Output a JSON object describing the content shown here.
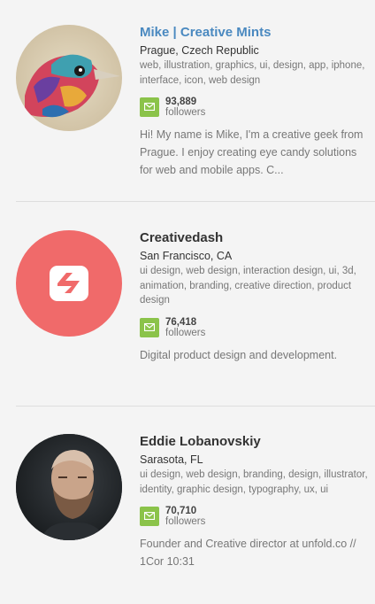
{
  "designers": [
    {
      "name": "Mike | Creative Mints",
      "location": "Prague, Czech Republic",
      "skills": "web, illustration, graphics, ui, design, app, iphone, interface, icon, web design",
      "followers_count": "93,889",
      "followers_label": "followers",
      "bio": "Hi! My name is Mike, I'm a creative geek from Prague. I enjoy creating eye candy solutions for web and mobile apps. C..."
    },
    {
      "name": "Creativedash",
      "location": "San Francisco, CA",
      "skills": "ui design, web design, interaction design, ui, 3d, animation, branding, creative direction, product design",
      "followers_count": "76,418",
      "followers_label": "followers",
      "bio": "Digital product design and development."
    },
    {
      "name": "Eddie Lobanovskiy",
      "location": "Sarasota, FL",
      "skills": "ui design, web design, branding, design, illustrator, identity, graphic design, typography, ux, ui",
      "followers_count": "70,710",
      "followers_label": "followers",
      "bio": "Founder and Creative director at unfold.co // 1Cor 10:31"
    }
  ],
  "colors": {
    "name_highlight": "#4a89c0",
    "follow_icon": "#8bc34a",
    "creativedash_brand": "#f06a6a"
  }
}
